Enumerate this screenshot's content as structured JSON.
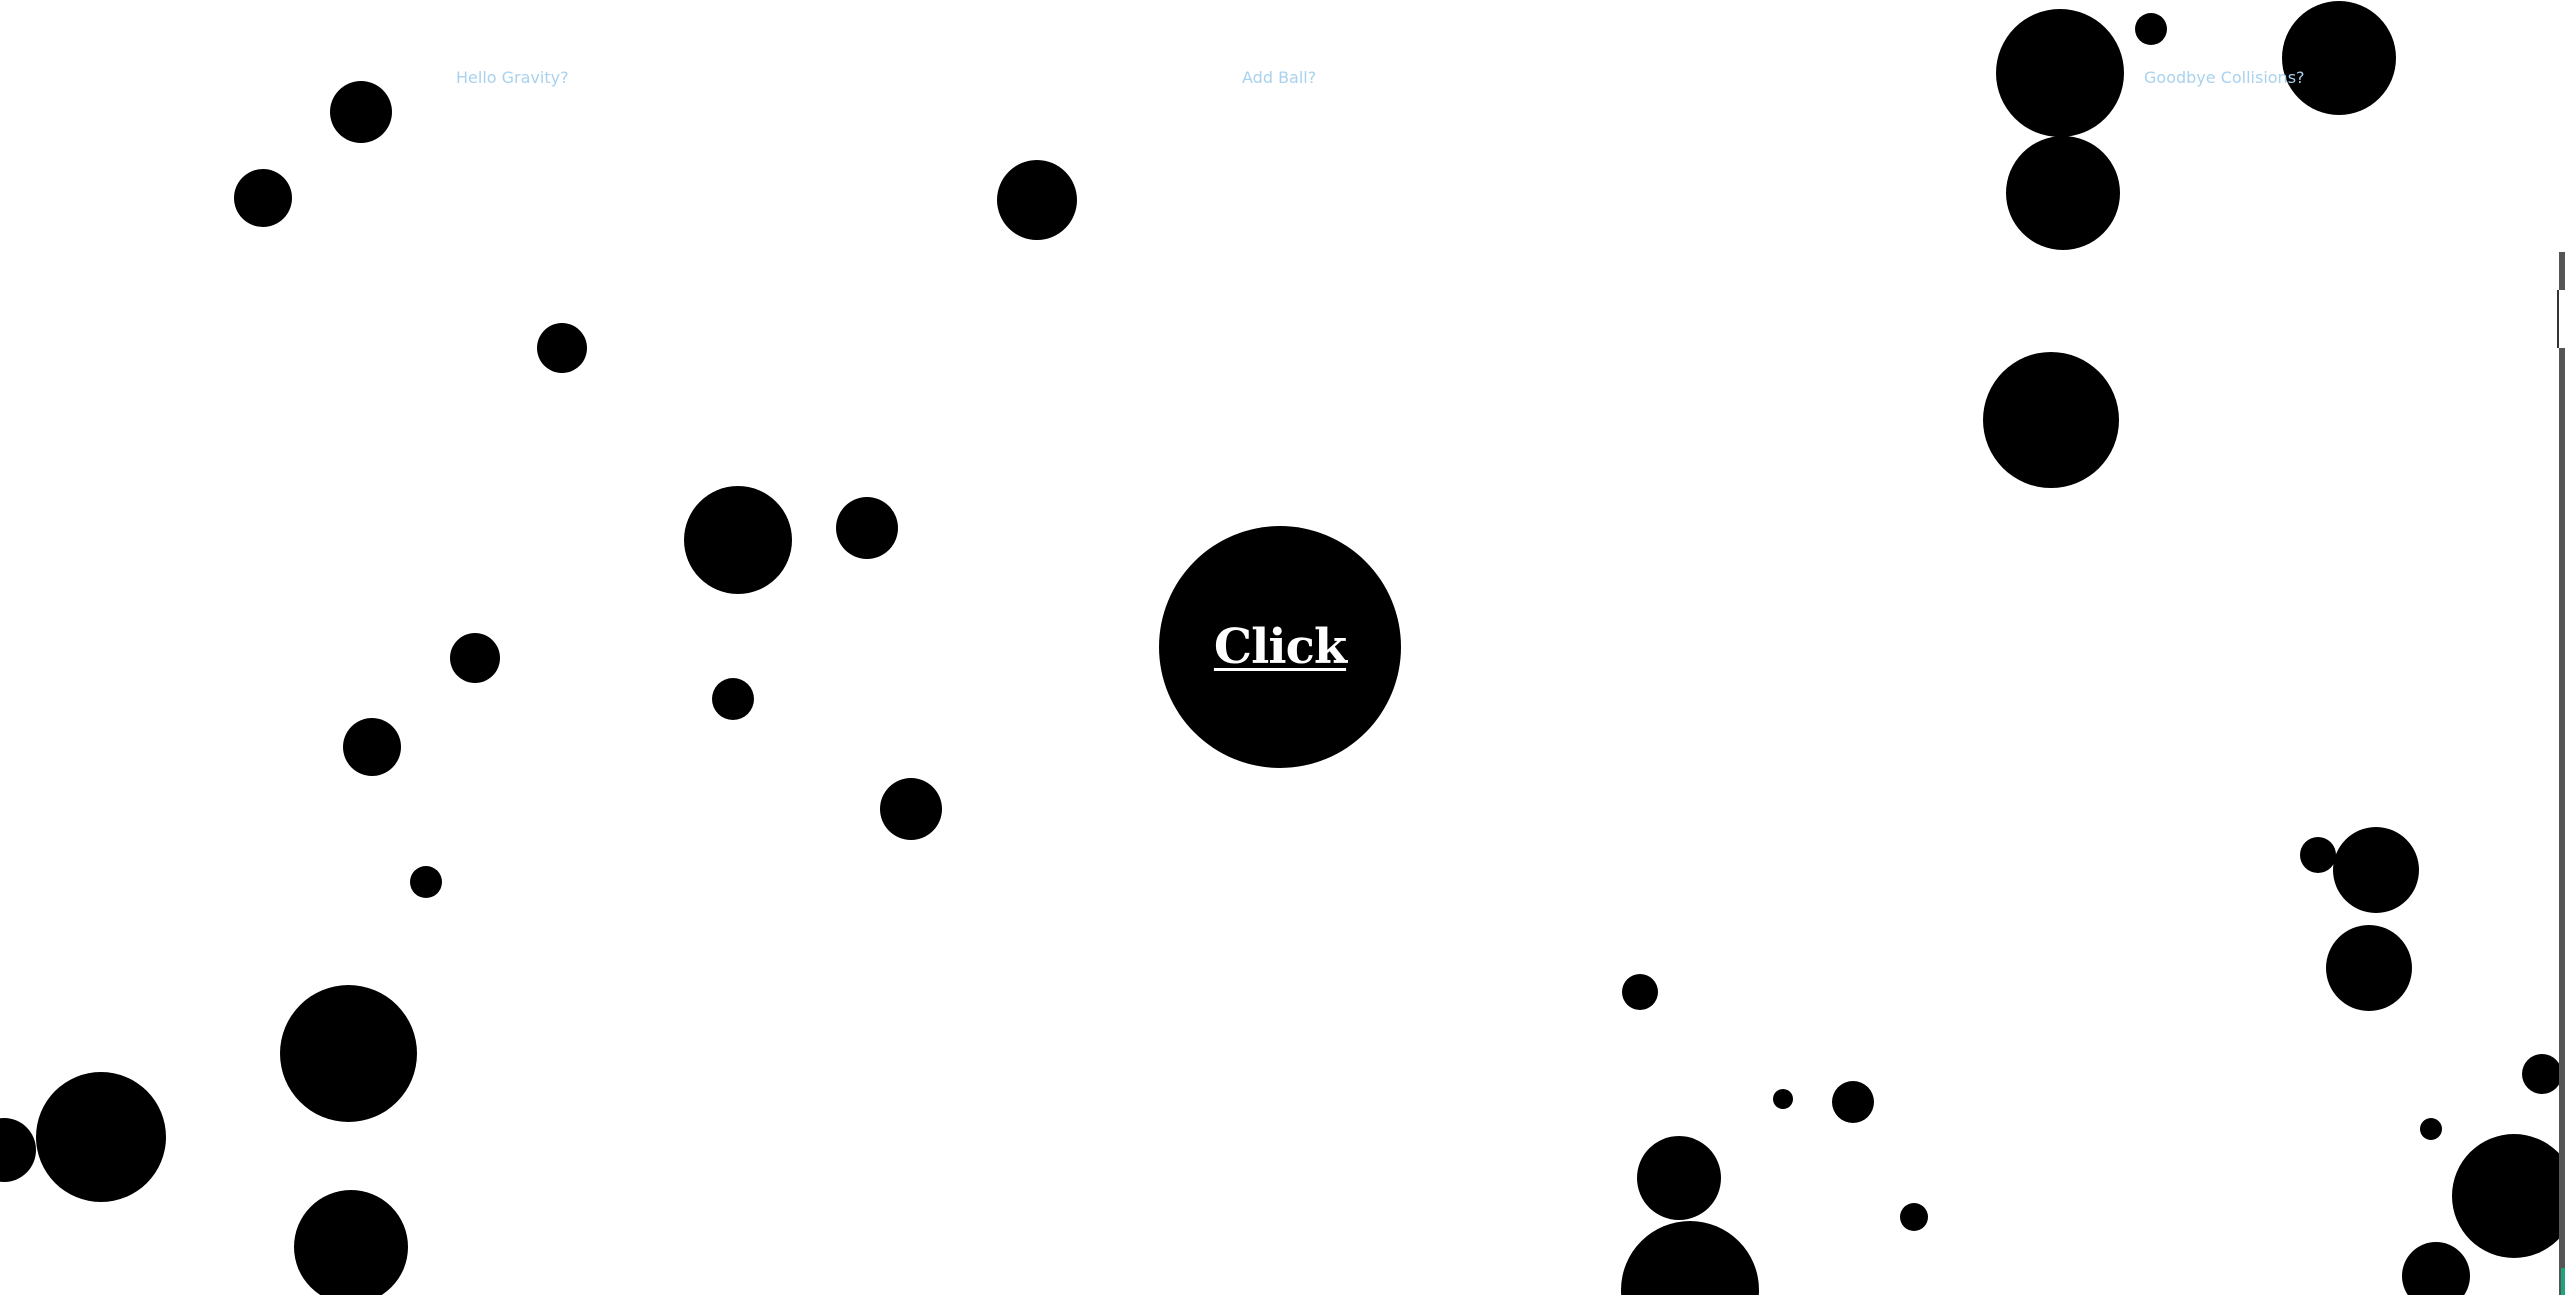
{
  "links": {
    "gravity": "Hello Gravity?",
    "add_ball": "Add Ball?",
    "collisions": "Goodbye Collisions?"
  },
  "center_button": {
    "label": "Click"
  },
  "colors": {
    "link": "#a9d2ee",
    "ball": "#000000",
    "background": "#ffffff",
    "button_text": "#ffffff"
  }
}
